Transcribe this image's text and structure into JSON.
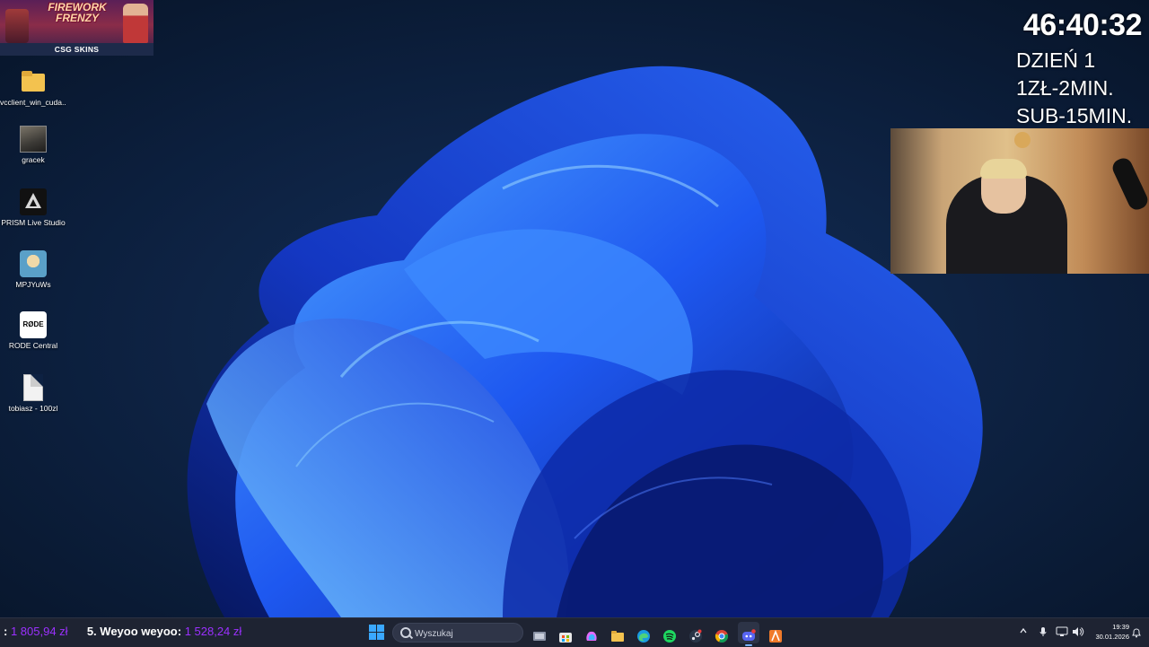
{
  "desktop": {
    "icons": [
      {
        "label": "vcclient_win_cuda...",
        "icon": "folder-icon"
      },
      {
        "label": "gracek",
        "icon": "photo-icon"
      },
      {
        "label": "PRISM Live Studio",
        "icon": "prism-icon"
      },
      {
        "label": "MPJYuWs",
        "icon": "avatar-icon"
      },
      {
        "label": "RODE Central",
        "icon": "rode-icon"
      },
      {
        "label": "tobiasz - 100zl",
        "icon": "file-icon"
      }
    ]
  },
  "banner": {
    "title": "FIREWORK FRENZY",
    "brand": "CSG SKINS"
  },
  "overlay": {
    "timer": "46:40:32",
    "lines": [
      "DZIEŃ 1",
      "1ZŁ-2MIN.",
      "SUB-15MIN."
    ]
  },
  "taskbar": {
    "donations": [
      {
        "name": ":",
        "amount": "1 805,94 zł"
      },
      {
        "name": "5. Weyoo weyoo:",
        "amount": "1 528,24 zł"
      }
    ],
    "search_placeholder": "Wyszukaj",
    "apps": [
      "task-view-icon",
      "store-icon",
      "copilot-icon",
      "file-explorer-icon",
      "edge-icon",
      "spotify-icon",
      "steam-icon",
      "chrome-icon",
      "discord-icon",
      "app-icon"
    ],
    "clock_time": "19:39",
    "clock_date": "30.01.2026"
  },
  "colors": {
    "donation_amount": "#9b30ff",
    "accent": "#3aa8ff"
  }
}
